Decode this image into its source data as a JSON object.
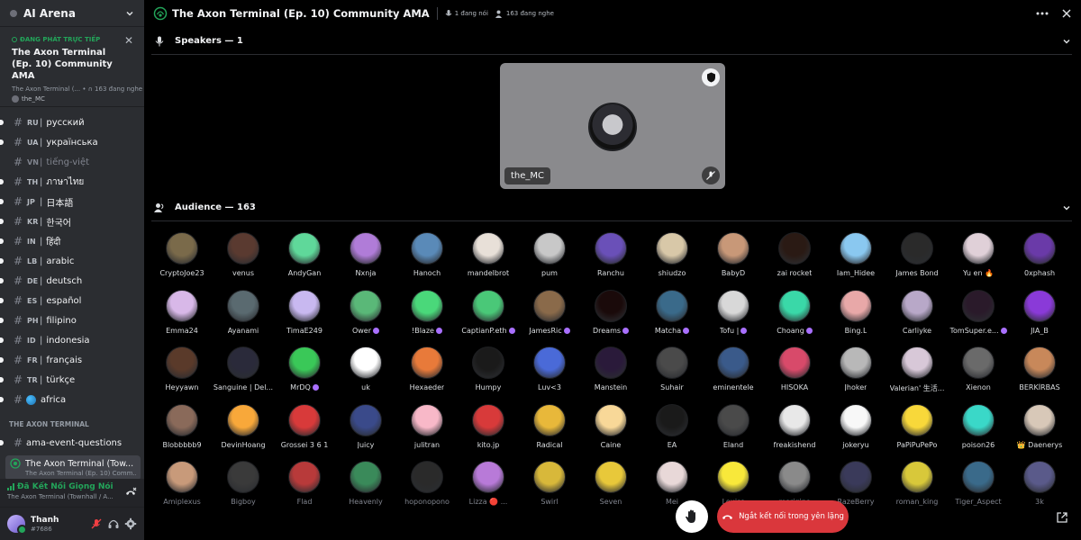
{
  "server": {
    "name": "AI Arena"
  },
  "live": {
    "tag": "ĐANG PHÁT TRỰC TIẾP",
    "title": "The Axon Terminal (Ep. 10) Community AMA",
    "meta": "The Axon Terminal (... • ∩ 163 đang nghe",
    "host": "the_MC"
  },
  "channels": [
    {
      "code": "RU",
      "name": "русский",
      "muted": false
    },
    {
      "code": "UA",
      "name": "українська",
      "muted": false
    },
    {
      "code": "VN",
      "name": "tiếng-việt",
      "muted": true
    },
    {
      "code": "TH",
      "name": "ภาษาไทย",
      "muted": false
    },
    {
      "code": "JP",
      "name": "日本語",
      "muted": false
    },
    {
      "code": "KR",
      "name": "한국어",
      "muted": false
    },
    {
      "code": "IN",
      "name": "हिंदी",
      "muted": false
    },
    {
      "code": "LB",
      "name": "arabic",
      "muted": false
    },
    {
      "code": "DE",
      "name": "deutsch",
      "muted": false
    },
    {
      "code": "ES",
      "name": "español",
      "muted": false
    },
    {
      "code": "PH",
      "name": "filipino",
      "muted": false
    },
    {
      "code": "ID",
      "name": "indonesia",
      "muted": false
    },
    {
      "code": "FR",
      "name": "français",
      "muted": false
    },
    {
      "code": "TR",
      "name": "türkçe",
      "muted": false
    },
    {
      "code": "",
      "name": "africa",
      "muted": false,
      "globe": true
    }
  ],
  "category": "THE AXON TERMINAL",
  "category_channel": "ama-event-questions",
  "active_channel": {
    "title": "The Axon Terminal (Tow...",
    "subtitle": "The Axon Terminal (Ep. 10) Comm..."
  },
  "voice": {
    "status": "Đã Kết Nối Giọng Nói",
    "channel": "The Axon Terminal (Townhall / A..."
  },
  "user": {
    "name": "Thanh",
    "tag": "#7686"
  },
  "topbar": {
    "title": "The Axon Terminal (Ep. 10) Community AMA",
    "speaking": "1 đang nói",
    "listening": "163 đang nghe"
  },
  "speakers_header": "Speakers — 1",
  "speaker": {
    "name": "the_MC"
  },
  "audience_header": "Audience — 163",
  "audience": [
    [
      {
        "name": "CryptoJoe23",
        "c": "#7a6a4a"
      },
      {
        "name": "venus",
        "c": "#5a3a30"
      },
      {
        "name": "AndyGan",
        "c": "#5fd89a"
      },
      {
        "name": "Nxnja",
        "c": "#b07cd8"
      },
      {
        "name": "Hanoch",
        "c": "#5a8ab8"
      },
      {
        "name": "mandelbrot",
        "c": "#e8e0d8"
      },
      {
        "name": "pum",
        "c": "#c8c8c8"
      },
      {
        "name": "Ranchu",
        "c": "#6a50b8"
      },
      {
        "name": "shiudzo",
        "c": "#d8c8a8"
      },
      {
        "name": "BabyD",
        "c": "#c89878"
      },
      {
        "name": "zai rocket",
        "c": "#2a1a14"
      },
      {
        "name": "Iam_Hidee",
        "c": "#8ac8f0"
      },
      {
        "name": "James Bond",
        "c": "#2a2a2a"
      },
      {
        "name": "Yu en 🔥",
        "c": "#e0d0d8"
      },
      {
        "name": "0xphash",
        "c": "#6a3aa8"
      }
    ],
    [
      {
        "name": "Emma24",
        "c": "#d8b8e8"
      },
      {
        "name": "Ayanami",
        "c": "#5a6a70"
      },
      {
        "name": "TimaE249",
        "c": "#c8b8f0"
      },
      {
        "name": "Ower",
        "c": "#5ab878",
        "b": true
      },
      {
        "name": "!Blaze",
        "c": "#4ad87a",
        "b": true
      },
      {
        "name": "CaptianP.eth",
        "c": "#4ac878",
        "b": true
      },
      {
        "name": "JamesRic",
        "c": "#8a6a4a",
        "b": true
      },
      {
        "name": "Dreams",
        "c": "#1a0a0a",
        "b": true
      },
      {
        "name": "Matcha",
        "c": "#3a6a8a",
        "b": true
      },
      {
        "name": "Tofu |",
        "c": "#d8d8d8",
        "b": true
      },
      {
        "name": "Choang",
        "c": "#3ad8a8",
        "b": true
      },
      {
        "name": "Bing.L",
        "c": "#e8a8a8"
      },
      {
        "name": "Carliyke",
        "c": "#b8a8c8"
      },
      {
        "name": "TomSuper.e...",
        "c": "#2a1a2a",
        "b": true
      },
      {
        "name": "JIA_B",
        "c": "#8a3ad8"
      }
    ],
    [
      {
        "name": "Heyyawn",
        "c": "#5a3a2a"
      },
      {
        "name": "Sanguine | Del...",
        "c": "#2a2a3a"
      },
      {
        "name": "MrDQ",
        "c": "#3ac858",
        "b": true
      },
      {
        "name": "uk",
        "c": "#ffffff"
      },
      {
        "name": "Hexaeder",
        "c": "#e87a3a"
      },
      {
        "name": "Humpy",
        "c": "#1a1a1a"
      },
      {
        "name": "Luv<3",
        "c": "#4a6ad8"
      },
      {
        "name": "Manstein",
        "c": "#2a1a3a"
      },
      {
        "name": "Suhair",
        "c": "#4a4a4a"
      },
      {
        "name": "eminentele",
        "c": "#3a5a8a"
      },
      {
        "name": "HISOKA",
        "c": "#d84a6a"
      },
      {
        "name": "Jhoker",
        "c": "#b8b8b8"
      },
      {
        "name": "Valerian' 生活...",
        "c": "#d8c8d8"
      },
      {
        "name": "Xienon",
        "c": "#6a6a6a"
      },
      {
        "name": "BERKİRBAS",
        "c": "#c8885a"
      }
    ],
    [
      {
        "name": "Blobbbbb9",
        "c": "#8a6a5a"
      },
      {
        "name": "DevinHoang",
        "c": "#f8a83a"
      },
      {
        "name": "Grossei 3 6 1",
        "c": "#d83a3a"
      },
      {
        "name": "Juicy",
        "c": "#3a4a8a"
      },
      {
        "name": "julitran",
        "c": "#f8b8c8"
      },
      {
        "name": "kito.jp",
        "c": "#d83a3a"
      },
      {
        "name": "Radical",
        "c": "#e8b83a"
      },
      {
        "name": "Caine",
        "c": "#f8d898"
      },
      {
        "name": "EA",
        "c": "#1a1a1a"
      },
      {
        "name": "Eland",
        "c": "#4a4a4a"
      },
      {
        "name": "freakishend",
        "c": "#e8e8e8"
      },
      {
        "name": "jokeryu",
        "c": "#f8f8f8"
      },
      {
        "name": "PaPiPuPePo",
        "c": "#f8d83a"
      },
      {
        "name": "poison26",
        "c": "#3ad8c8"
      },
      {
        "name": "👑 Daenerys",
        "c": "#d8c8b8"
      }
    ],
    [
      {
        "name": "Amiplexus",
        "c": "#c89a7a"
      },
      {
        "name": "Bigboy",
        "c": "#3a3a3a"
      },
      {
        "name": "Flad",
        "c": "#b83a3a"
      },
      {
        "name": "Heavenly",
        "c": "#3a8a5a"
      },
      {
        "name": "hoponopono",
        "c": "#2a2a2a"
      },
      {
        "name": "Lizza 🔴 ...",
        "c": "#b87ad8"
      },
      {
        "name": "Swirl",
        "c": "#d8b83a"
      },
      {
        "name": "Seven",
        "c": "#e8c83a"
      },
      {
        "name": "Mei",
        "c": "#e8d8d8"
      },
      {
        "name": "Louiss",
        "c": "#f8e83a"
      },
      {
        "name": "merigino",
        "c": "#8a8a8a"
      },
      {
        "name": "RazeBerry",
        "c": "#3a3a5a"
      },
      {
        "name": "roman_king",
        "c": "#d8c83a"
      },
      {
        "name": "Tiger_Aspect",
        "c": "#3a6a8a"
      },
      {
        "name": "3k",
        "c": "#5a5a8a"
      }
    ]
  ],
  "leave_label": "Ngắt kết nối trong yên lặng"
}
